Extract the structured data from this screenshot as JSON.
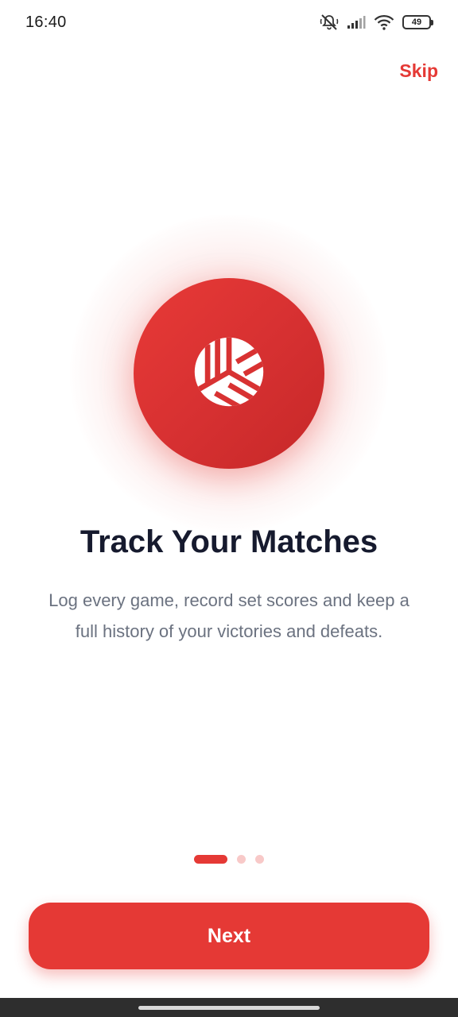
{
  "status_bar": {
    "time": "16:40",
    "battery": "49",
    "icons": [
      "mute-icon",
      "signal-icon",
      "wifi-icon",
      "battery-icon"
    ]
  },
  "header": {
    "skip_label": "Skip"
  },
  "hero": {
    "icon": "volleyball-icon"
  },
  "content": {
    "title": "Track Your Matches",
    "description": "Log every game, record set scores and keep a full history of your victories and defeats."
  },
  "pager": {
    "total": 3,
    "current": 1
  },
  "footer": {
    "next_label": "Next"
  },
  "colors": {
    "accent": "#e53935",
    "title": "#161a2e",
    "description": "#6b7280",
    "dot_inactive": "#f8c9c8"
  }
}
